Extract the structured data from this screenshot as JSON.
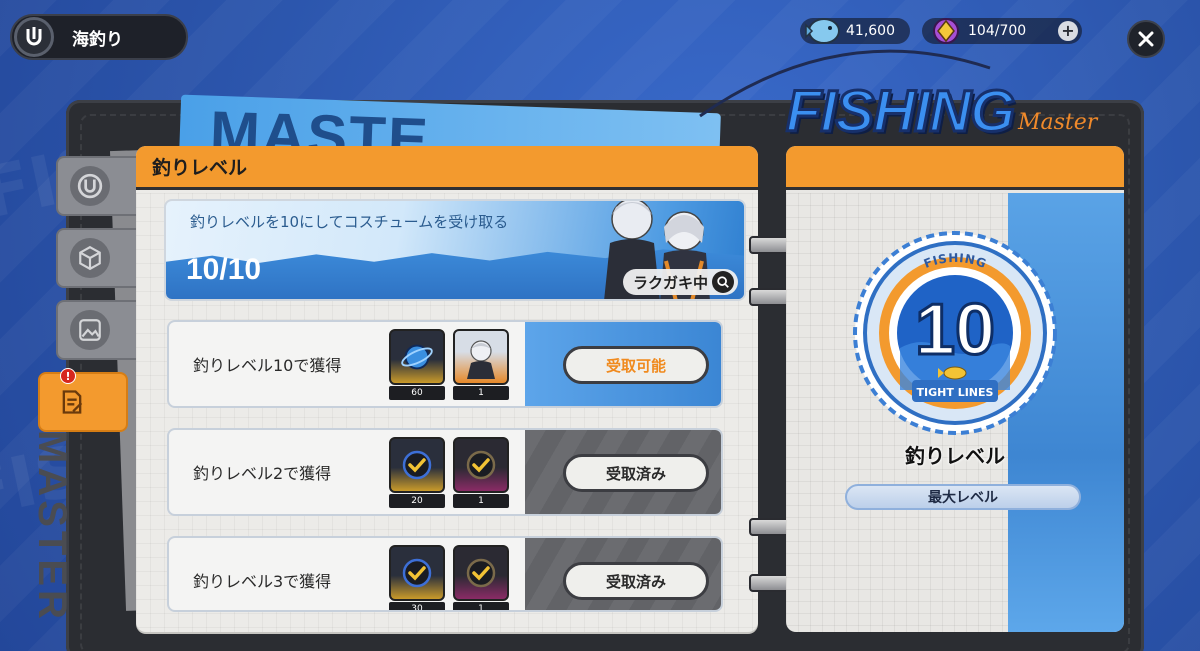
{
  "header": {
    "title": "海釣り"
  },
  "currency": [
    {
      "name": "fish-currency",
      "value": "41,600"
    },
    {
      "name": "stamina",
      "value": "104/700"
    }
  ],
  "logo": {
    "word": "FISHING",
    "sub": "Master"
  },
  "background_sheet": {
    "word": "MASTE",
    "side_word": "MASTER"
  },
  "panel": {
    "title": "釣りレベル"
  },
  "banner": {
    "text": "釣りレベルを10にしてコスチュームを受け取る",
    "progress": "10/10",
    "badge": "ラクガキ中"
  },
  "rewards": [
    {
      "label": "釣りレベル10で獲得",
      "items": [
        {
          "qty": "60",
          "style": "gold"
        },
        {
          "qty": "1",
          "style": "orange"
        }
      ],
      "button": "受取可能",
      "state": "claimable"
    },
    {
      "label": "釣りレベル2で獲得",
      "items": [
        {
          "qty": "20",
          "style": "gold"
        },
        {
          "qty": "1",
          "style": "purple"
        }
      ],
      "button": "受取済み",
      "state": "claimed"
    },
    {
      "label": "釣りレベル3で獲得",
      "items": [
        {
          "qty": "30",
          "style": "gold"
        },
        {
          "qty": "1",
          "style": "purple"
        }
      ],
      "button": "受取済み",
      "state": "claimed"
    }
  ],
  "level": {
    "value": "10",
    "ring_top": "FISHING",
    "ring_bottom": "TIGHT LINES",
    "title": "釣りレベル",
    "status": "最大レベル"
  },
  "colors": {
    "accent_orange": "#f39a2e",
    "claim_text": "#f08a1e",
    "background_blue": "#2f5bb5"
  }
}
